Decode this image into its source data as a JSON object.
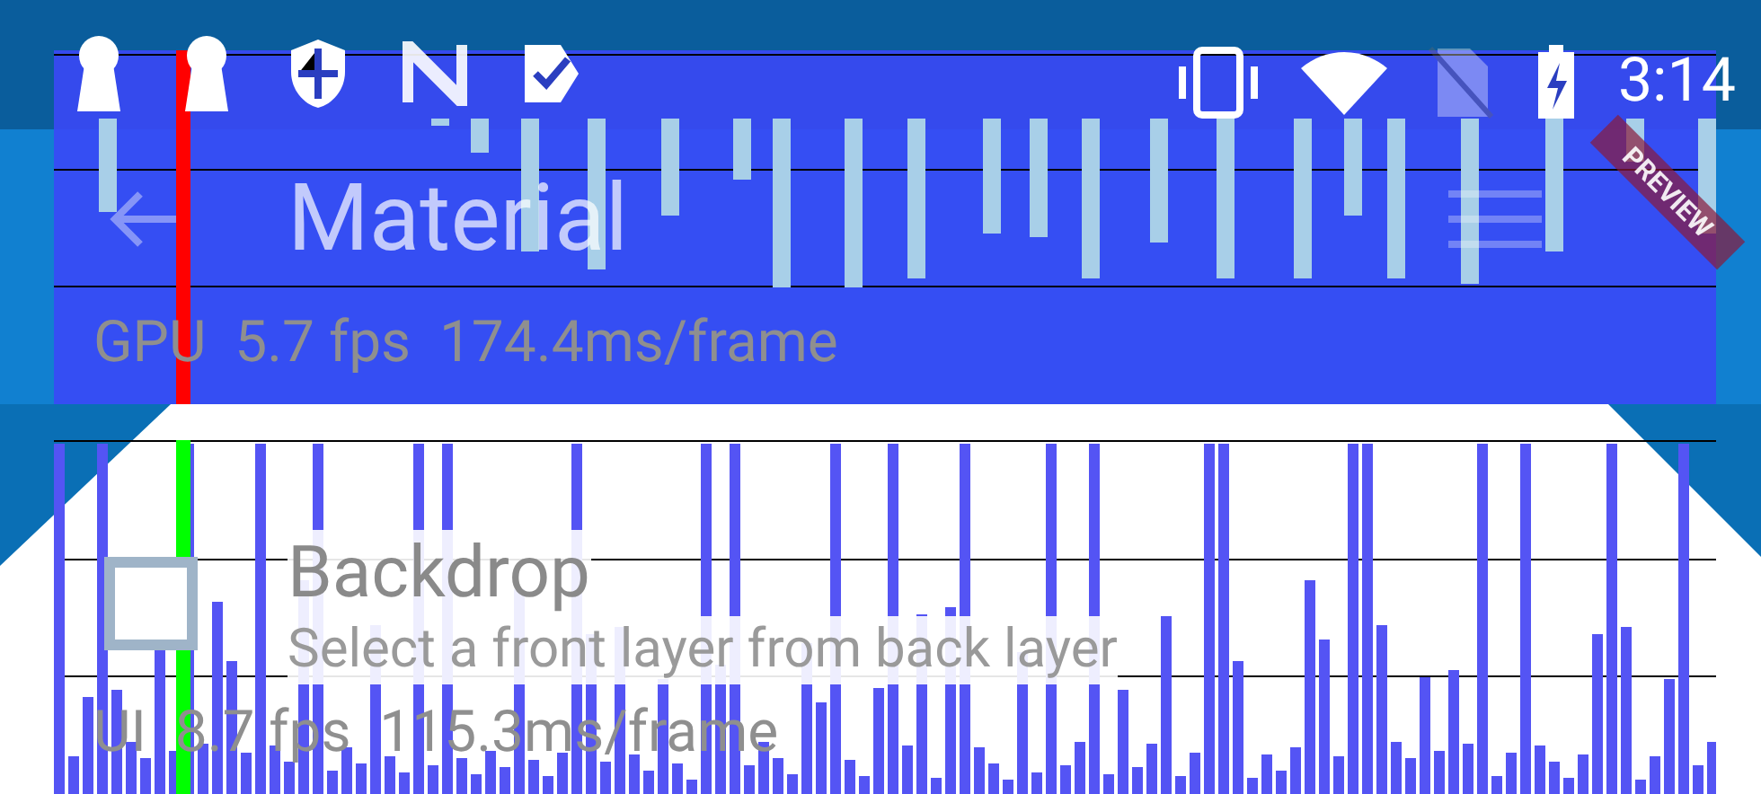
{
  "status_bar": {
    "time": "3:14"
  },
  "app_bar": {
    "title": "Material"
  },
  "debug_banner": {
    "text": "PREVIEW"
  },
  "list_item": {
    "title": "Backdrop",
    "subtitle": "Select a front layer from back layer"
  },
  "gpu_overlay": {
    "label": "GPU  5.7 fps  174.4ms/frame"
  },
  "ui_overlay": {
    "label": "UI  8.7 fps  115.3ms/frame"
  }
}
